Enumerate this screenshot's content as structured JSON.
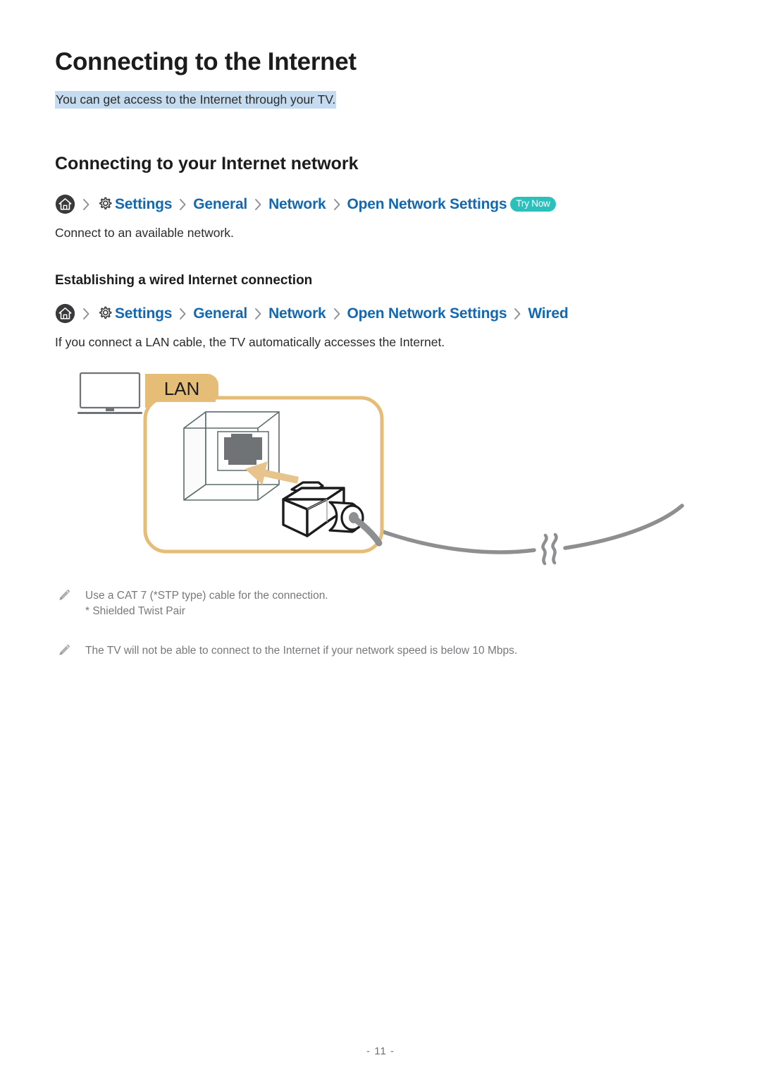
{
  "document": {
    "title": "Connecting to the Internet",
    "lead": "You can get access to the Internet through your TV.",
    "lead_highlight_color": "#c5dcf0",
    "page_number": "- 11 -"
  },
  "sections": [
    {
      "heading": "Connecting to your Internet network",
      "breadcrumb": {
        "home_icon": "home-icon",
        "gear_icon": "gear-icon",
        "separator": "chevron-right-icon",
        "items": [
          "Settings",
          "General",
          "Network",
          "Open Network Settings"
        ],
        "badge": "Try Now",
        "badge_color": "#2cc0bd",
        "link_color": "#1268b3"
      },
      "paragraph": "Connect to an available network."
    },
    {
      "heading": "Establishing a wired Internet connection",
      "breadcrumb": {
        "home_icon": "home-icon",
        "gear_icon": "gear-icon",
        "separator": "chevron-right-icon",
        "items": [
          "Settings",
          "General",
          "Network",
          "Open Network Settings",
          "Wired"
        ],
        "badge": null,
        "link_color": "#1268b3"
      },
      "paragraph": "If you connect a LAN cable, the TV automatically accesses the Internet."
    }
  ],
  "illustration": {
    "name": "lan-wired-connection-diagram",
    "tab_label": "LAN",
    "tab_color": "#e5bd77",
    "tv_icon": "television-icon",
    "jack_icon": "rj45-wall-jack-icon",
    "plug_icon": "rj45-plug-icon",
    "arrow_icon": "insert-arrow-icon",
    "cable_icon": "lan-cable-icon",
    "break_icon": "cable-break-icon",
    "cable_color": "#8d8f91"
  },
  "notes": [
    {
      "icon": "pencil-note-icon",
      "text": "Use a CAT 7 (*STP type) cable for the connection.",
      "subtext": "* Shielded Twist Pair"
    },
    {
      "icon": "pencil-note-icon",
      "text": "The TV will not be able to connect to the Internet if your network speed is below 10 Mbps.",
      "subtext": null
    }
  ]
}
